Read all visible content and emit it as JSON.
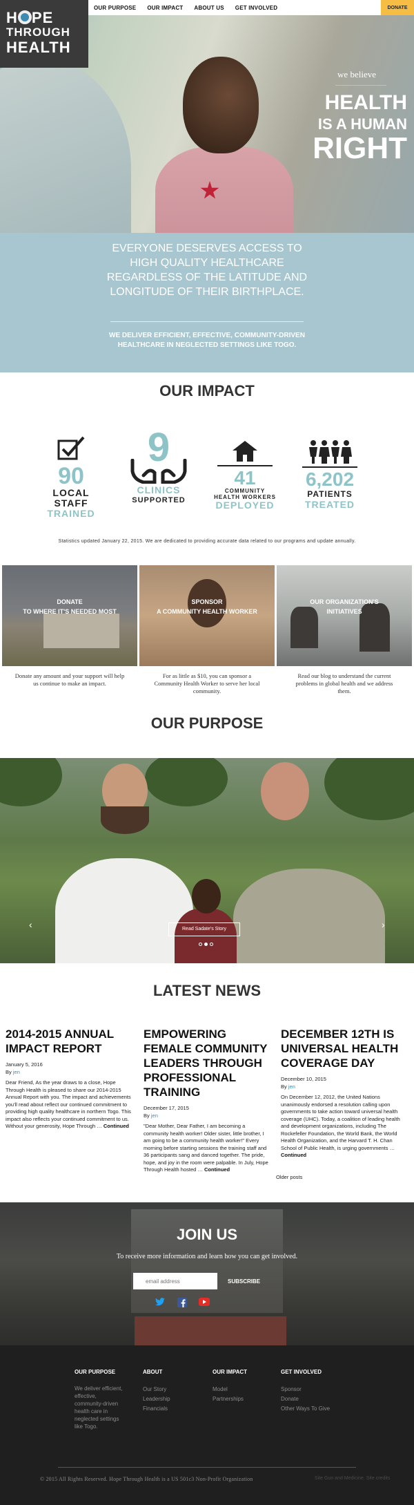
{
  "logo": {
    "line1a": "H",
    "line1b": "PE",
    "line2": "THROUGH",
    "line3": "HEALTH"
  },
  "nav": {
    "items": [
      "OUR PURPOSE",
      "OUR IMPACT",
      "ABOUT US",
      "GET INVOLVED"
    ],
    "donate": "DONATE"
  },
  "hero": {
    "we_believe": "we believe",
    "line1": "HEALTH",
    "line2": "IS A HUMAN",
    "line3": "RIGHT"
  },
  "mission": {
    "headline": "EVERYONE DESERVES ACCESS TO HIGH QUALITY HEALTHCARE REGARDLESS OF THE LATITUDE AND LONGITUDE OF THEIR BIRTHPLACE.",
    "sub": "WE DELIVER EFFICIENT, EFFECTIVE, COMMUNITY-DRIVEN HEALTHCARE IN NEGLECTED SETTINGS LIKE TOGO."
  },
  "impact": {
    "title": "OUR IMPACT",
    "stats": [
      {
        "num": "90",
        "l1": "LOCAL",
        "l2": "STAFF",
        "sub": "TRAINED"
      },
      {
        "num": "9",
        "l1": "CLINICS",
        "l2": "SUPPORTED"
      },
      {
        "num": "41",
        "l1": "COMMUNITY",
        "l2": "HEALTH WORKERS",
        "sub": "DEPLOYED"
      },
      {
        "num": "6,202",
        "l1": "PATIENTS",
        "sub": "TREATED"
      }
    ],
    "note": "Statistics updated January 22, 2015. We are dedicated to providing accurate data related to our programs and update annually."
  },
  "cards": [
    {
      "title": "DONATE",
      "subtitle": "TO WHERE IT'S NEEDED MOST",
      "text": "Donate any amount and your support will help us continue to make an impact."
    },
    {
      "title": "SPONSOR",
      "subtitle": "A COMMUNITY HEALTH WORKER",
      "text": "For as little as $10, you can sponsor a Community Health Worker to serve her local community."
    },
    {
      "title": "OUR ORGANIZATION'S",
      "subtitle": "INITIATIVES",
      "text": "Read our blog to understand the current problems in global health and we address them."
    }
  ],
  "purpose": {
    "title": "OUR PURPOSE",
    "story": "Read Sadate's Story",
    "prev": "‹",
    "next": "›"
  },
  "news": {
    "title": "LATEST NEWS",
    "posts": [
      {
        "title": "2014-2015 ANNUAL IMPACT REPORT",
        "date": "January 5, 2016",
        "by": "By",
        "author": "jen",
        "excerpt": "Dear Friend, As the year draws to a close, Hope Through Health is pleased to share our 2014-2015 Annual Report with you. The impact and achievements you'll read about reflect our continued commitment to providing high quality healthcare in northern Togo. This impact also reflects your continued commitment to us. Without your generosity, Hope Through …",
        "more": "Continued"
      },
      {
        "title": "EMPOWERING FEMALE COMMUNITY LEADERS THROUGH PROFESSIONAL TRAINING",
        "date": "December 17, 2015",
        "by": "By",
        "author": "jen",
        "excerpt": "\"Dear Mother, Dear Father, I am becoming a community health worker! Older sister, little brother, I am going to be a community health worker!\" Every morning before starting sessions the training staff and 36 participants sang and danced together. The pride, hope, and joy in the room were palpable. In July, Hope Through Health hosted …",
        "more": "Continued"
      },
      {
        "title": "DECEMBER 12TH IS UNIVERSAL HEALTH COVERAGE DAY",
        "date": "December 10, 2015",
        "by": "By",
        "author": "jen",
        "excerpt": "On December 12, 2012, the United Nations unanimously endorsed a resolution calling upon governments to take action toward universal health coverage (UHC). Today, a coalition of leading health and development organizations, including The Rockefeller Foundation, the World Bank, the World Health Organization, and the Harvard T. H. Chan School of Public Health, is urging governments …",
        "more": "Continued"
      }
    ],
    "older": "Older posts"
  },
  "join": {
    "title": "JOIN US",
    "lead": "To receive more information and learn how you can get involved.",
    "placeholder": "email address",
    "subscribe": "SUBSCRIBE"
  },
  "footer": {
    "cols": [
      {
        "title": "OUR PURPOSE",
        "text": "We deliver efficient, effective, community-driven health care in neglected settings like Togo."
      },
      {
        "title": "ABOUT",
        "links": [
          "Our Story",
          "Leadership",
          "Financials"
        ]
      },
      {
        "title": "OUR IMPACT",
        "links": [
          "Model",
          "Partnerships"
        ]
      },
      {
        "title": "GET INVOLVED",
        "links": [
          "Sponsor",
          "Donate",
          "Other Ways To Give"
        ]
      }
    ],
    "copyright": "© 2015 All Rights Reserved. Hope Through Health is a US 501c3 Non-Profit Organization",
    "credit": "Site Gun and Medicine. Site credits"
  },
  "colors": {
    "accent": "#f5bd43",
    "teal": "#8ec4c8",
    "band": "#a7c6cf",
    "link": "#3d8bb3"
  }
}
